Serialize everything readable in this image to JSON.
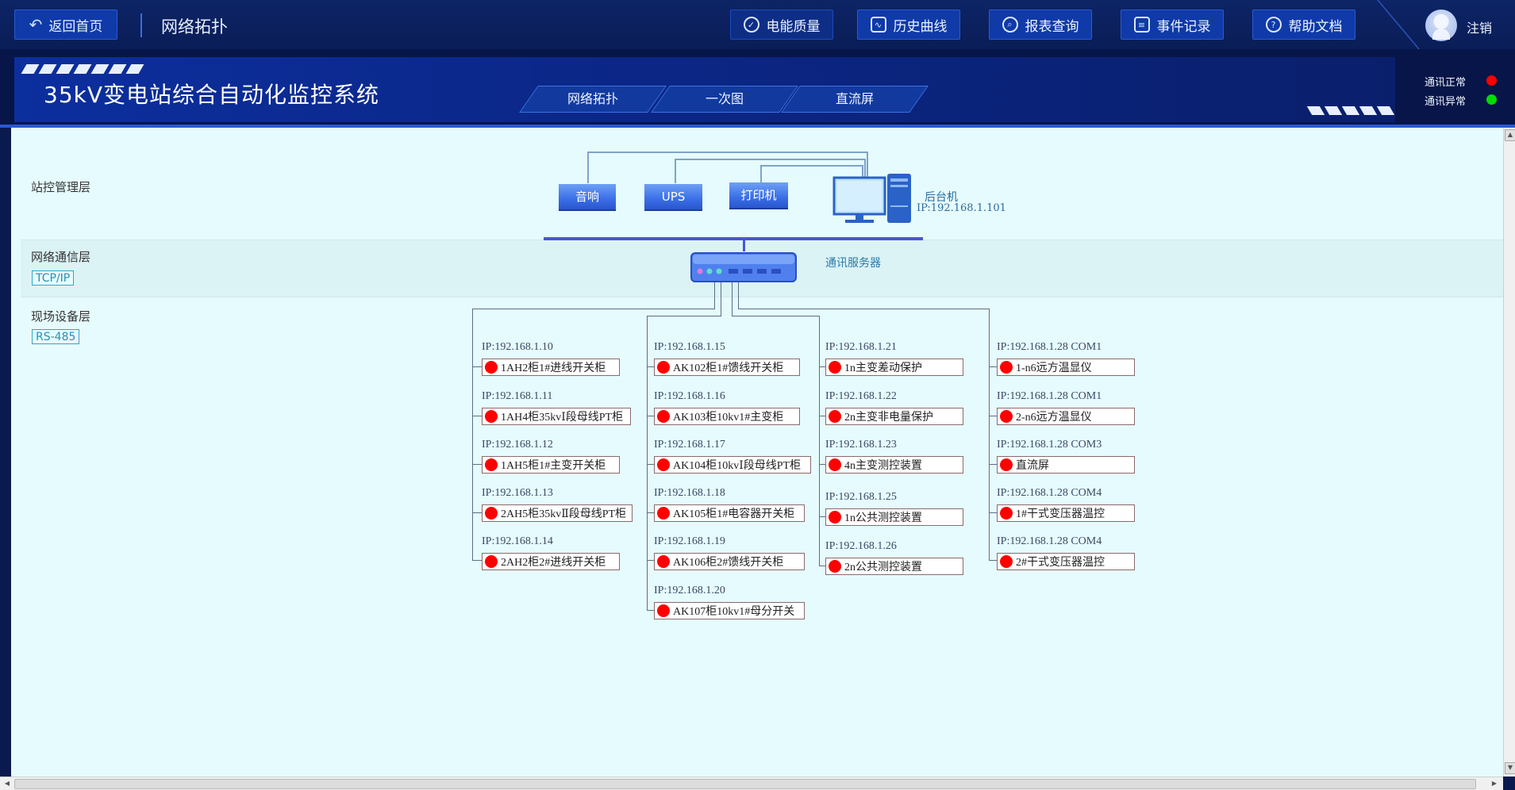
{
  "header": {
    "back_label": "返回首页",
    "page_name": "网络拓扑",
    "nav": [
      {
        "label": "电能质量",
        "icon": "shield-icon"
      },
      {
        "label": "历史曲线",
        "icon": "chart-icon"
      },
      {
        "label": "报表查询",
        "icon": "search-icon"
      },
      {
        "label": "事件记录",
        "icon": "document-icon"
      },
      {
        "label": "帮助文档",
        "icon": "help-icon"
      }
    ],
    "logout_label": "注销"
  },
  "title": {
    "system_name": "35kV变电站综合自动化监控系统",
    "tabs": [
      "网络拓扑",
      "一次图",
      "直流屏"
    ],
    "legend": [
      {
        "label": "通讯正常",
        "color": "#ff0000"
      },
      {
        "label": "通讯异常",
        "color": "#00dd00"
      }
    ]
  },
  "layers": {
    "station": "站控管理层",
    "network": "网络通信层",
    "network_protocol": "TCP/IP",
    "field": "现场设备层",
    "field_protocol": "RS-485"
  },
  "station_devices": [
    "音响",
    "UPS",
    "打印机"
  ],
  "host": {
    "label": "后台机",
    "ip": "IP:192.168.1.101"
  },
  "server_label": "通讯服务器",
  "status_color": "#ff0000",
  "field_columns": [
    [
      {
        "ip": "IP:192.168.1.10",
        "name": "1AH2柜1#进线开关柜"
      },
      {
        "ip": "IP:192.168.1.11",
        "name": "1AH4柜35kvⅠ段母线PT柜"
      },
      {
        "ip": "IP:192.168.1.12",
        "name": "1AH5柜1#主变开关柜"
      },
      {
        "ip": "IP:192.168.1.13",
        "name": "2AH5柜35kvⅡ段母线PT柜"
      },
      {
        "ip": "IP:192.168.1.14",
        "name": "2AH2柜2#进线开关柜"
      }
    ],
    [
      {
        "ip": "IP:192.168.1.15",
        "name": "AK102柜1#馈线开关柜"
      },
      {
        "ip": "IP:192.168.1.16",
        "name": "AK103柜10kv1#主变柜"
      },
      {
        "ip": "IP:192.168.1.17",
        "name": "AK104柜10kvⅠ段母线PT柜"
      },
      {
        "ip": "IP:192.168.1.18",
        "name": "AK105柜1#电容器开关柜"
      },
      {
        "ip": "IP:192.168.1.19",
        "name": "AK106柜2#馈线开关柜"
      },
      {
        "ip": "IP:192.168.1.20",
        "name": "AK107柜10kv1#母分开关"
      }
    ],
    [
      {
        "ip": "IP:192.168.1.21",
        "name": "1n主变差动保护"
      },
      {
        "ip": "IP:192.168.1.22",
        "name": "2n主变非电量保护"
      },
      {
        "ip": "IP:192.168.1.23",
        "name": "4n主变测控装置"
      },
      {
        "ip": "IP:192.168.1.25",
        "name": "1n公共测控装置"
      },
      {
        "ip": "IP:192.168.1.26",
        "name": "2n公共测控装置"
      }
    ],
    [
      {
        "ip": "IP:192.168.1.28 COM1",
        "name": "1-n6远方温显仪"
      },
      {
        "ip": "IP:192.168.1.28 COM1",
        "name": "2-n6远方温显仪"
      },
      {
        "ip": "IP:192.168.1.28 COM3",
        "name": "直流屏"
      },
      {
        "ip": "IP:192.168.1.28 COM4",
        "name": "1#干式变压器温控"
      },
      {
        "ip": "IP:192.168.1.28 COM4",
        "name": "2#干式变压器温控"
      }
    ]
  ]
}
